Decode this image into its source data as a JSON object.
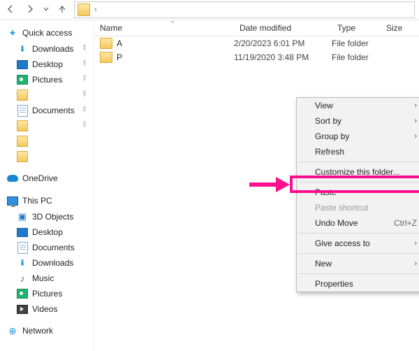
{
  "nav": {
    "address_icon": "folder-icon"
  },
  "columns": {
    "name": "Name",
    "date": "Date modified",
    "type": "Type",
    "size": "Size"
  },
  "files": [
    {
      "name": "A",
      "date": "2/20/2023 6:01 PM",
      "type": "File folder"
    },
    {
      "name": "P",
      "date": "11/19/2020 3:48 PM",
      "type": "File folder"
    }
  ],
  "sidebar": {
    "quick_access": "Quick access",
    "downloads": "Downloads",
    "desktop": "Desktop",
    "pictures": "Pictures",
    "documents": "Documents",
    "onedrive": "OneDrive",
    "this_pc": "This PC",
    "objects3d": "3D Objects",
    "desktop2": "Desktop",
    "documents2": "Documents",
    "downloads2": "Downloads",
    "music": "Music",
    "pictures2": "Pictures",
    "videos": "Videos",
    "network": "Network"
  },
  "context_menu": {
    "view": "View",
    "sort_by": "Sort by",
    "group_by": "Group by",
    "refresh": "Refresh",
    "customize": "Customize this folder...",
    "paste": "Paste",
    "paste_shortcut": "Paste shortcut",
    "undo_move": "Undo Move",
    "undo_hotkey": "Ctrl+Z",
    "give_access": "Give access to",
    "new": "New",
    "properties": "Properties"
  }
}
